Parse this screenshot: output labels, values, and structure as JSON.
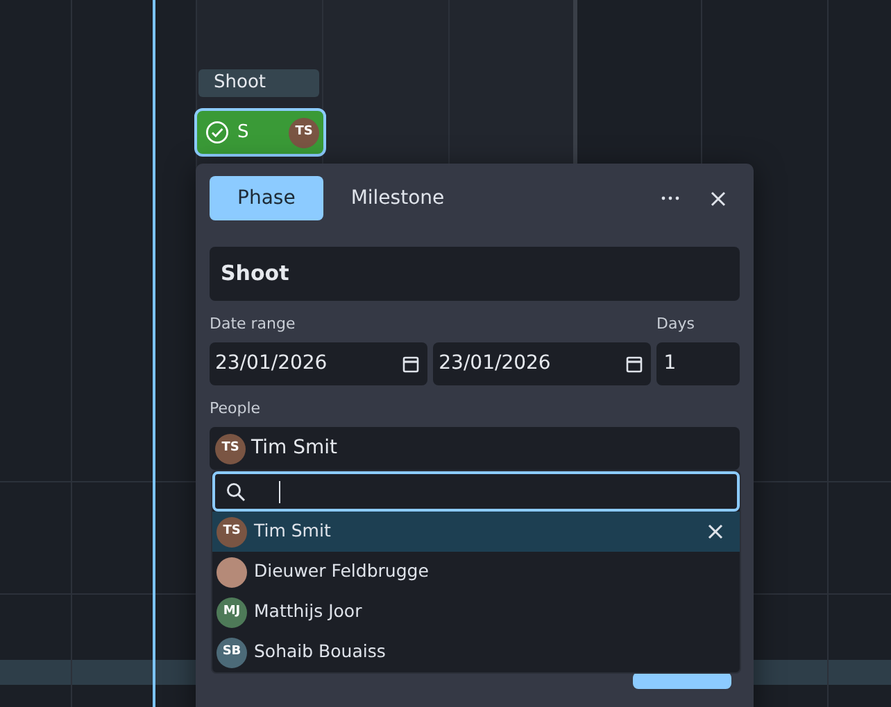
{
  "timeline": {
    "label": "Shoot",
    "bar": {
      "text": "S",
      "done": true,
      "selected": true,
      "avatar": {
        "initials": "TS",
        "color": "#7a5543"
      }
    }
  },
  "popup": {
    "tabs": [
      {
        "label": "Phase",
        "selected": true
      },
      {
        "label": "Milestone",
        "selected": false
      }
    ],
    "name": "Shoot",
    "date_label": "Date range",
    "start": "23/01/2026",
    "end": "23/01/2026",
    "days_label": "Days",
    "days": "1",
    "people_label": "People",
    "people": [
      {
        "initials": "TS",
        "name": "Tim Smit",
        "color": "#7a5543"
      }
    ],
    "options": [
      {
        "kind": "initials",
        "initials": "TS",
        "name": "Tim Smit",
        "color": "#7a5543",
        "selected": true
      },
      {
        "kind": "photo",
        "name": "Dieuwer Feldbrugge",
        "selected": false
      },
      {
        "kind": "initials",
        "initials": "MJ",
        "name": "Matthijs Joor",
        "color": "#4e7a58",
        "selected": false
      },
      {
        "kind": "initials",
        "initials": "SB",
        "name": "Sohaib Bouaiss",
        "color": "#4c6a78",
        "selected": false
      }
    ]
  }
}
